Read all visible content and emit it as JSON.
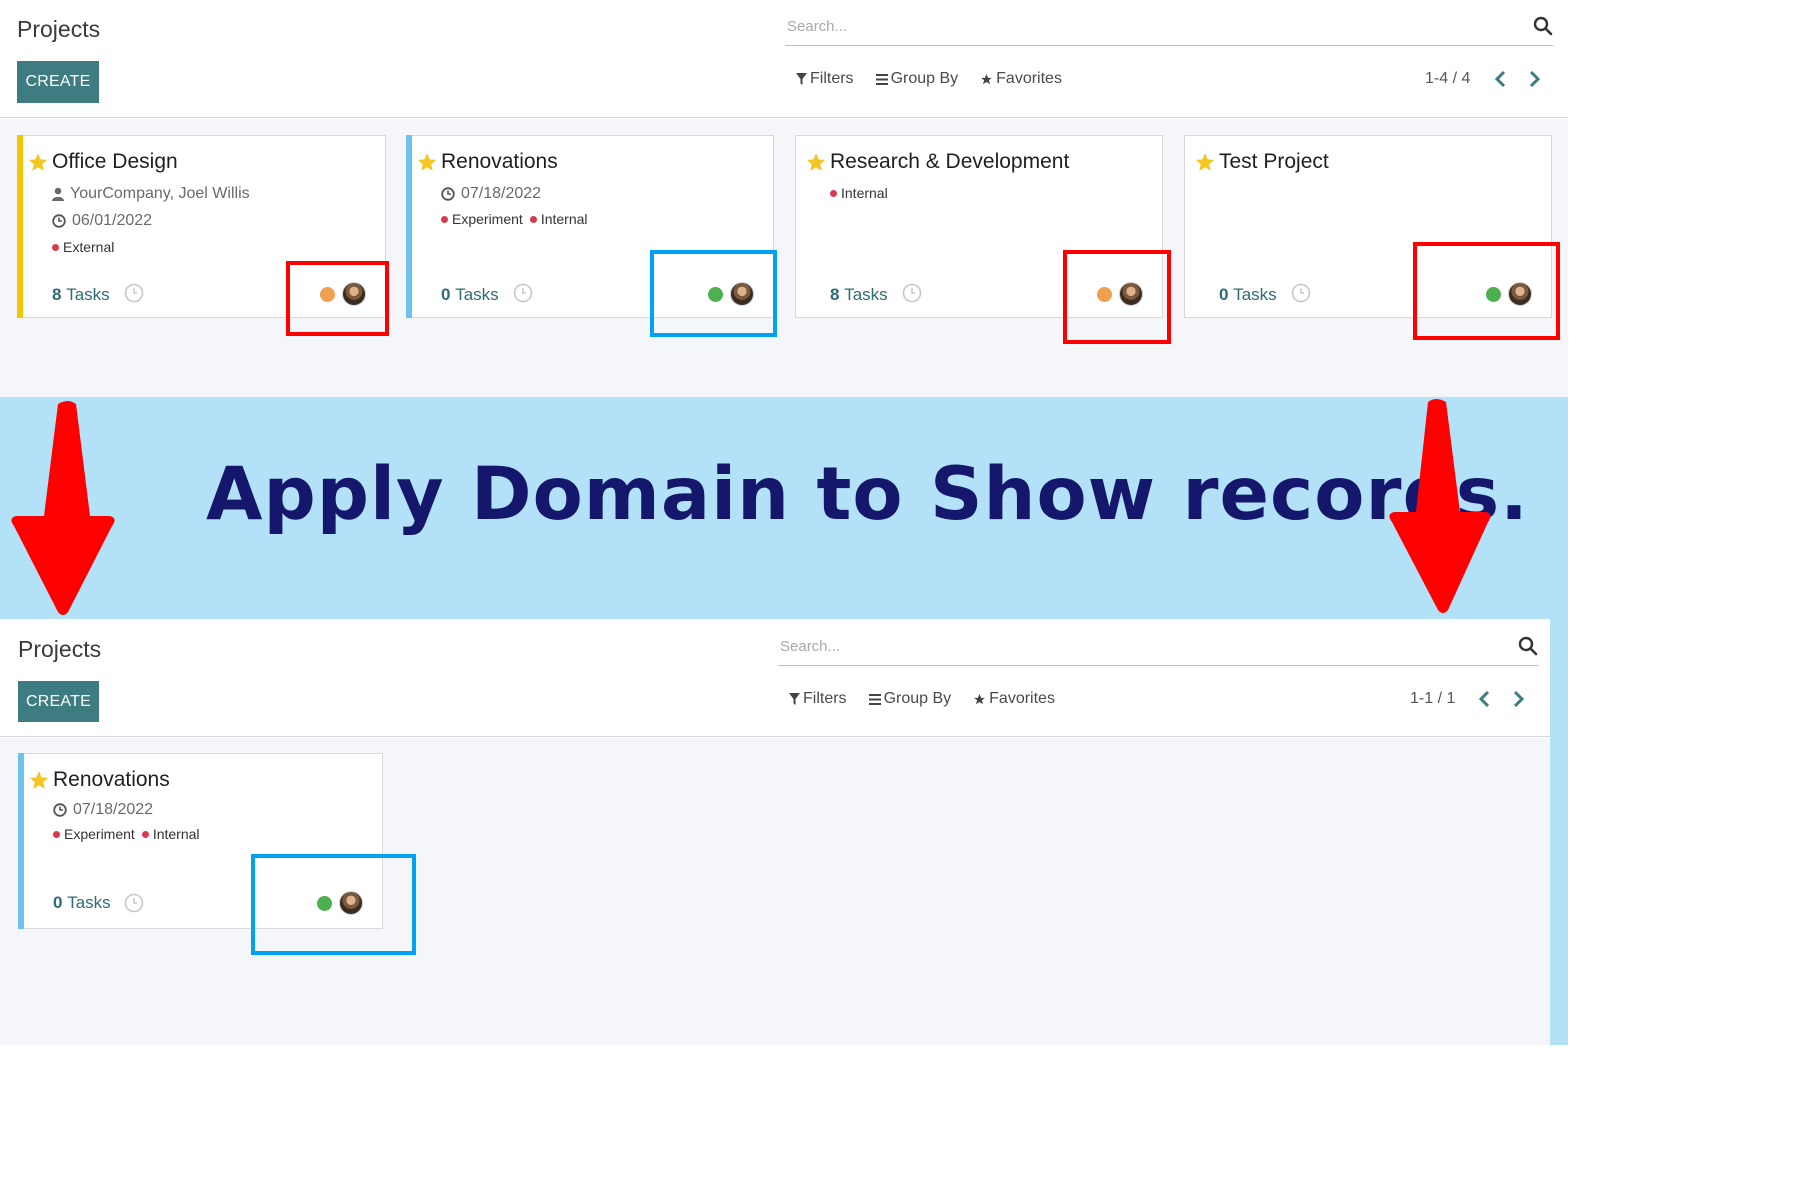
{
  "top": {
    "title": "Projects",
    "create_label": "CREATE",
    "search_placeholder": "Search...",
    "filters_label": "Filters",
    "groupby_label": "Group By",
    "favorites_label": "Favorites",
    "pager": "1-4 / 4",
    "cards": [
      {
        "name": "Office Design",
        "customer": "YourCompany, Joel Willis",
        "date": "06/01/2022",
        "tags": [
          "External"
        ],
        "tasks_count": "8",
        "tasks_label": "Tasks",
        "status_color": "#f0a050",
        "band_color": "#f4c400"
      },
      {
        "name": "Renovations",
        "date": "07/18/2022",
        "tags": [
          "Experiment",
          "Internal"
        ],
        "tasks_count": "0",
        "tasks_label": "Tasks",
        "status_color": "#4caf50",
        "band_color": "#6fc1ee"
      },
      {
        "name": "Research & Development",
        "tags": [
          "Internal"
        ],
        "tasks_count": "8",
        "tasks_label": "Tasks",
        "status_color": "#f0a050"
      },
      {
        "name": "Test Project",
        "tasks_count": "0",
        "tasks_label": "Tasks",
        "status_color": "#4caf50"
      }
    ]
  },
  "banner": {
    "text": "Apply Domain to Show records."
  },
  "bottom": {
    "title": "Projects",
    "create_label": "CREATE",
    "search_placeholder": "Search...",
    "filters_label": "Filters",
    "groupby_label": "Group By",
    "favorites_label": "Favorites",
    "pager": "1-1 / 1",
    "cards": [
      {
        "name": "Renovations",
        "date": "07/18/2022",
        "tags": [
          "Experiment",
          "Internal"
        ],
        "tasks_count": "0",
        "tasks_label": "Tasks",
        "status_color": "#4caf50",
        "band_color": "#6fc1ee"
      }
    ]
  },
  "colors": {
    "primary": "#3d7c81",
    "highlight_red": "#ff0000",
    "highlight_blue": "#00a2f3",
    "banner_bg": "#b3e2f8",
    "banner_text": "#14176b"
  },
  "icons": [
    "search-icon",
    "filter-icon",
    "group-by-icon",
    "favorites-star-icon",
    "chevron-left-icon",
    "chevron-right-icon",
    "star-icon",
    "user-icon",
    "clock-icon",
    "activity-clock-icon",
    "status-dot",
    "avatar",
    "down-arrow-icon"
  ]
}
